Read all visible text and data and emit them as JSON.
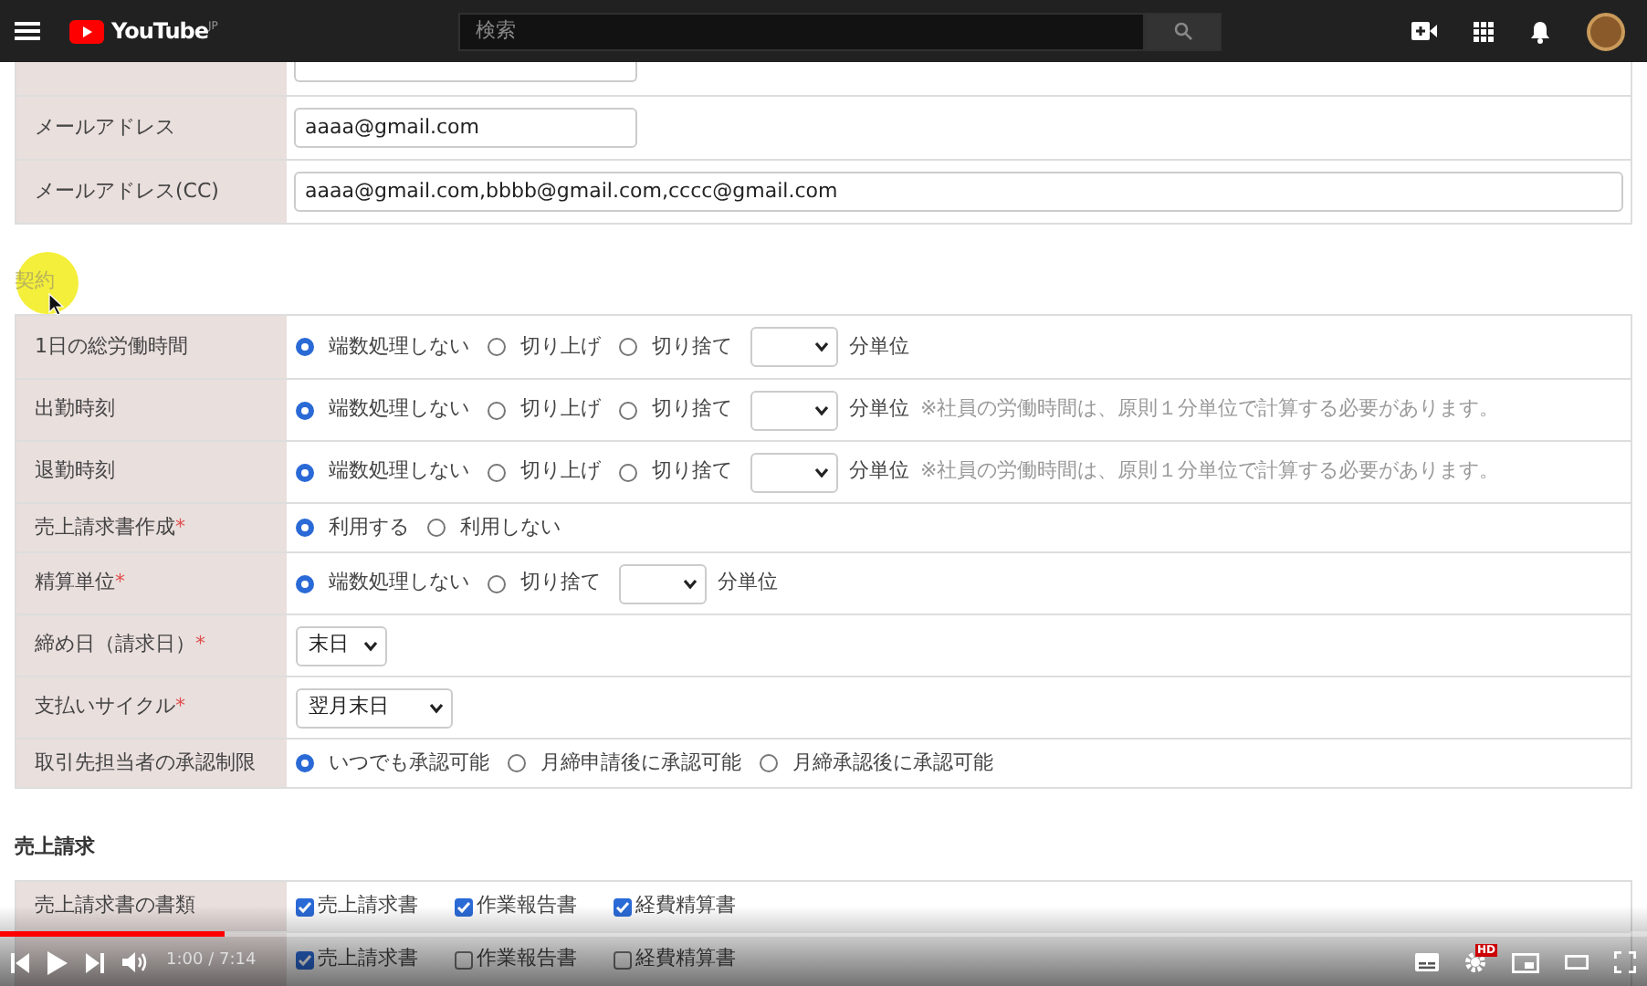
{
  "header": {
    "logo": "YouTube",
    "region": "JP",
    "search_placeholder": "検索"
  },
  "contact_rows": [
    {
      "label": "メールアドレス",
      "value": "aaaa@gmail.com",
      "wide": false
    },
    {
      "label": "メールアドレス(CC)",
      "value": "aaaa@gmail.com,bbbb@gmail.com,cccc@gmail.com",
      "wide": true
    }
  ],
  "sections": [
    {
      "title": "契約",
      "highlighted": true,
      "rows": [
        {
          "label": "1日の総労働時間",
          "controls": [
            {
              "kind": "radio",
              "label": "端数処理しない",
              "selected": true
            },
            {
              "kind": "radio",
              "label": "切り上げ",
              "selected": false
            },
            {
              "kind": "radio",
              "label": "切り捨て",
              "selected": false
            },
            {
              "kind": "select"
            },
            {
              "kind": "unit",
              "text": "分単位"
            }
          ]
        },
        {
          "label": "出勤時刻",
          "controls": [
            {
              "kind": "radio",
              "label": "端数処理しない",
              "selected": true
            },
            {
              "kind": "radio",
              "label": "切り上げ",
              "selected": false
            },
            {
              "kind": "radio",
              "label": "切り捨て",
              "selected": false
            },
            {
              "kind": "select"
            },
            {
              "kind": "unit",
              "text": "分単位"
            },
            {
              "kind": "note",
              "text": "※社員の労働時間は、原則１分単位で計算する必要があります。"
            }
          ]
        },
        {
          "label": "退勤時刻",
          "controls": [
            {
              "kind": "radio",
              "label": "端数処理しない",
              "selected": true
            },
            {
              "kind": "radio",
              "label": "切り上げ",
              "selected": false
            },
            {
              "kind": "radio",
              "label": "切り捨て",
              "selected": false
            },
            {
              "kind": "select"
            },
            {
              "kind": "unit",
              "text": "分単位"
            },
            {
              "kind": "note",
              "text": "※社員の労働時間は、原則１分単位で計算する必要があります。"
            }
          ]
        },
        {
          "label": "売上請求書作成",
          "required_mark": "*",
          "controls": [
            {
              "kind": "radio",
              "label": "利用する",
              "selected": true
            },
            {
              "kind": "radio",
              "label": "利用しない",
              "selected": false
            }
          ]
        },
        {
          "label": "精算単位",
          "required_mark": "*",
          "controls": [
            {
              "kind": "radio",
              "label": "端数処理しない",
              "selected": true
            },
            {
              "kind": "radio",
              "label": "切り捨て",
              "selected": false
            },
            {
              "kind": "select"
            },
            {
              "kind": "unit",
              "text": "分単位"
            }
          ]
        },
        {
          "label": "締め日（請求日）",
          "required_mark": "*",
          "controls": [
            {
              "kind": "select",
              "value": "末日"
            }
          ]
        },
        {
          "label": "支払いサイクル",
          "required_mark": "*",
          "controls": [
            {
              "kind": "select",
              "value": "翌月末日"
            }
          ]
        },
        {
          "label": "取引先担当者の承認制限",
          "controls": [
            {
              "kind": "radio",
              "label": "いつでも承認可能",
              "selected": true
            },
            {
              "kind": "radio",
              "label": "月締申請後に承認可能",
              "selected": false
            },
            {
              "kind": "radio",
              "label": "月締承認後に承認可能",
              "selected": false
            }
          ]
        }
      ]
    },
    {
      "title": "売上請求",
      "rows": [
        {
          "label": "売上請求書の書類",
          "controls": [
            {
              "kind": "checkbox",
              "label": "売上請求書",
              "checked": true
            },
            {
              "kind": "checkbox",
              "label": "作業報告書",
              "checked": true
            },
            {
              "kind": "checkbox",
              "label": "経費精算書",
              "checked": true
            }
          ]
        },
        {
          "controls": [
            {
              "kind": "checkbox",
              "label": "売上請求書",
              "checked": true
            },
            {
              "kind": "checkbox",
              "label": "作業報告書",
              "checked": false
            },
            {
              "kind": "checkbox",
              "label": "経費精算書",
              "checked": false
            }
          ]
        }
      ]
    }
  ],
  "player": {
    "level": 0.136,
    "time": "1:00 / 7:14",
    "quality_badge": "HD"
  }
}
